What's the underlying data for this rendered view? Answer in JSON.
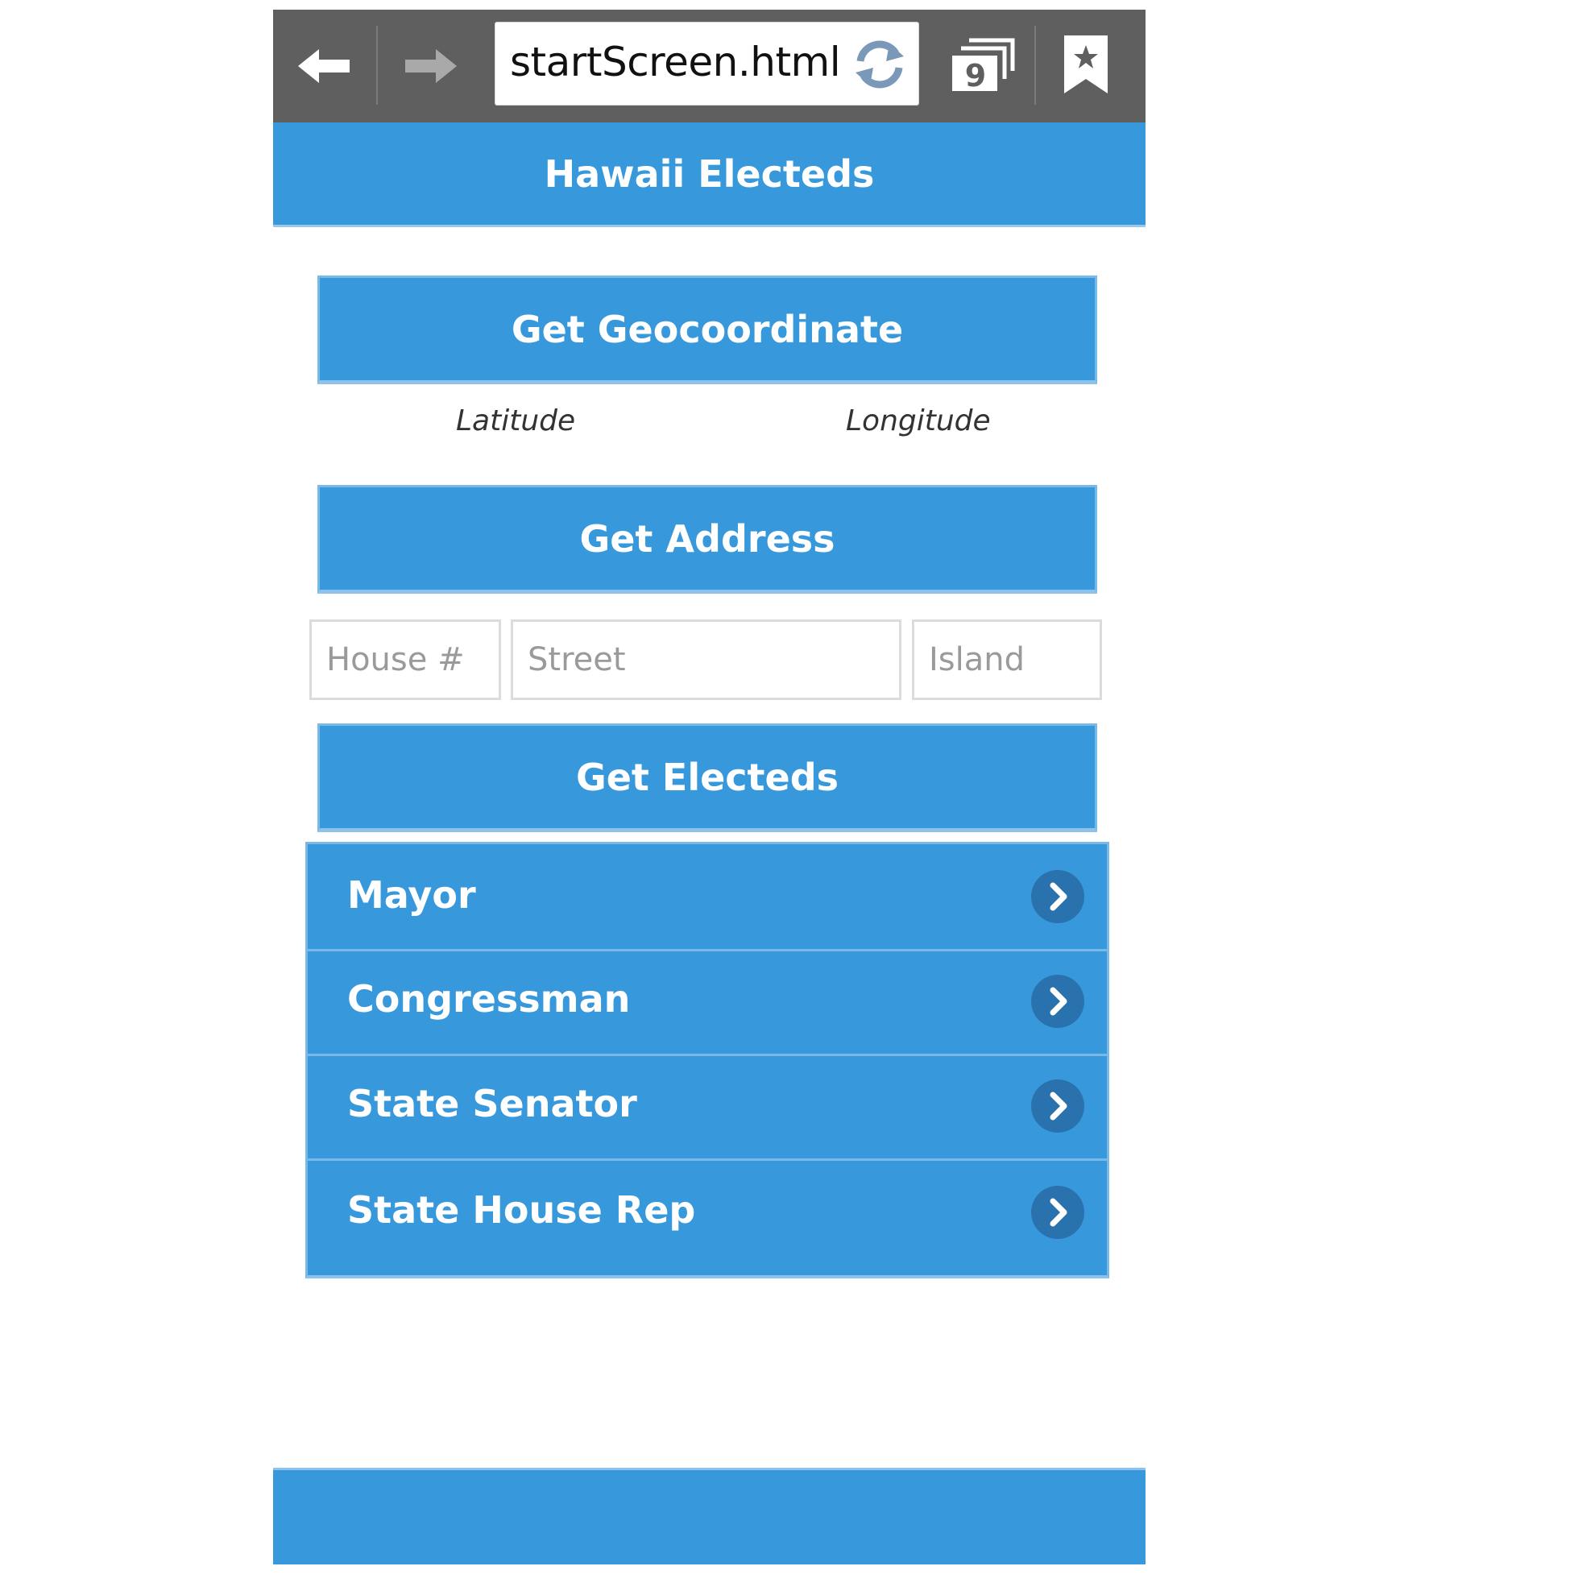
{
  "browser": {
    "url": "startScreen.html",
    "tab_count": "9",
    "icons": [
      "back-arrow-icon",
      "forward-arrow-icon",
      "reload-icon",
      "tabs-icon",
      "bookmark-icon"
    ]
  },
  "header": {
    "title": "Hawaii Electeds"
  },
  "main": {
    "geo_button_label": "Get Geocoordinate",
    "latitude_label": "Latitude",
    "longitude_label": "Longitude",
    "address_button_label": "Get Address",
    "fields": {
      "house_placeholder": "House #",
      "street_placeholder": "Street",
      "island_placeholder": "Island"
    },
    "electeds_button_label": "Get Electeds",
    "officials": [
      {
        "label": "Mayor"
      },
      {
        "label": "Congressman"
      },
      {
        "label": "State Senator"
      },
      {
        "label": "State House Rep"
      }
    ]
  },
  "colors": {
    "accent": "#3798dc",
    "chrome": "#5f5f5f",
    "chevron_circle": "#2a72ad"
  }
}
